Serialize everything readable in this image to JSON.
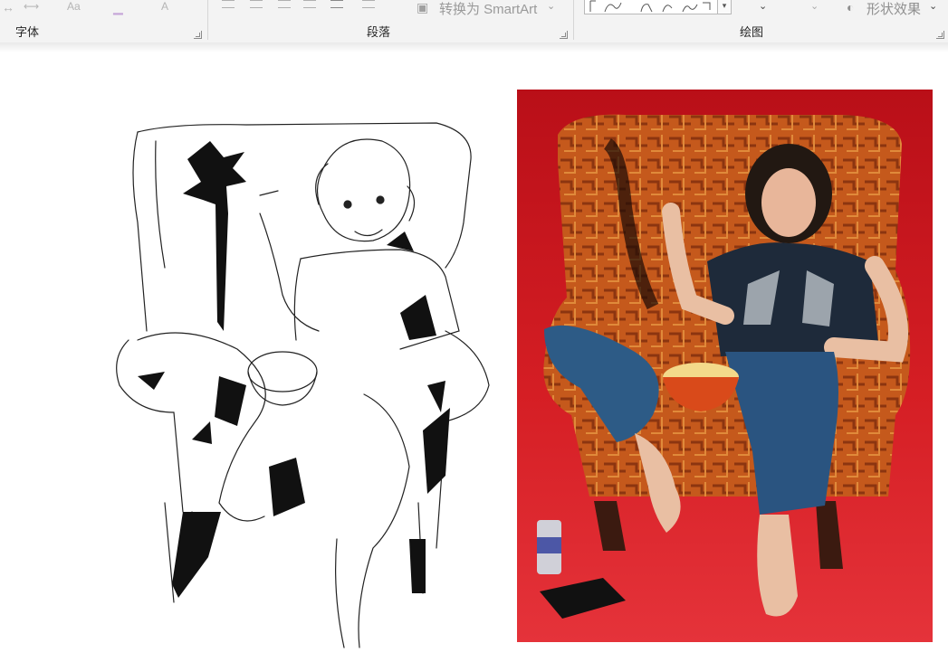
{
  "ribbon": {
    "groups": [
      {
        "label": "字体"
      },
      {
        "label": "段落"
      },
      {
        "label": "绘图"
      }
    ],
    "commands": {
      "smartart_label": "转换为 SmartArt",
      "shape_effects_label": "形状效果"
    },
    "icons": {
      "font_aa": "Aa",
      "font_a": "A"
    }
  },
  "colors": {
    "ribbon_bg": "#f3f3f3",
    "photo_bg": "#c8141b",
    "chair_orange": "#c5591c",
    "jeans": "#2d5b86",
    "shirt": "#1e2a3a"
  }
}
